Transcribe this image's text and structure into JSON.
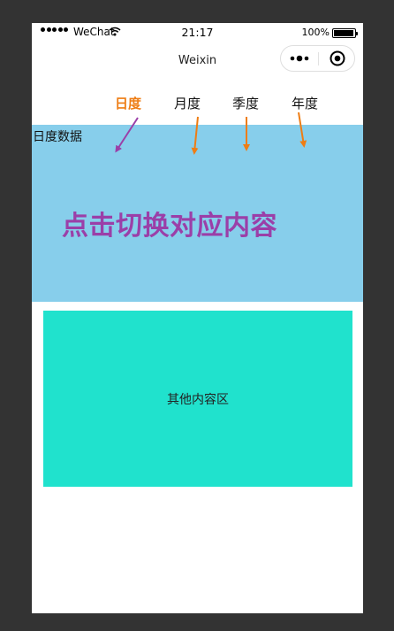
{
  "status_bar": {
    "carrier": "WeChat",
    "time": "21:17",
    "battery": "100%",
    "signal_icon": "signal-dots-icon",
    "wifi_icon": "wifi-icon",
    "battery_icon": "battery-icon"
  },
  "nav": {
    "title": "Weixin",
    "more_icon": "more-icon",
    "close_icon": "close-icon"
  },
  "tabs": [
    {
      "label": "日度",
      "active": true
    },
    {
      "label": "月度",
      "active": false
    },
    {
      "label": "季度",
      "active": false
    },
    {
      "label": "年度",
      "active": false
    }
  ],
  "panel": {
    "label": "日度数据",
    "hint": "点击切换对应内容"
  },
  "other": {
    "label": "其他内容区"
  },
  "colors": {
    "background": "#333333",
    "active_tab": "#ee7d14",
    "arrow_orange": "#ee7d14",
    "arrow_purple": "#9b3fa8",
    "panel": "#87ceeb",
    "hint_text": "#9b3fa8",
    "other_area": "#20e2cd"
  }
}
